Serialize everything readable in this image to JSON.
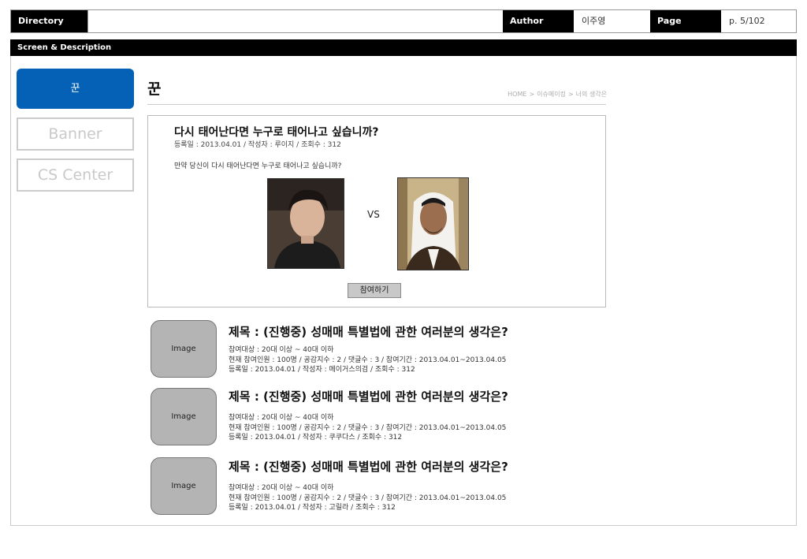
{
  "header": {
    "directory_label": "Directory",
    "directory_value": "",
    "author_label": "Author",
    "author_value": "이주영",
    "page_label": "Page",
    "page_value": "p. 5/102"
  },
  "section_bar": "Screen & Description",
  "menu": {
    "active": "꾼",
    "items": [
      "Banner",
      "CS Center"
    ]
  },
  "page_title": "꾼",
  "breadcrumb": [
    "HOME",
    "이슈메이킹",
    "너의 생각은"
  ],
  "poll": {
    "question": "다시 태어난다면 누구로 태어나고 싶습니까?",
    "meta": "등록일 : 2013.04.01 / 작성자 : 루이지 / 조회수 : 312",
    "description": "만약 당신이 다시 태어난다면 누구로 태어나고 싶습니까?",
    "vs": "VS",
    "join_button": "참여하기"
  },
  "list": [
    {
      "thumb": "Image",
      "title": "제목 : (진행중) 성매매 특별법에 관한 여러분의 생각은?",
      "target": "참여대상 : 20대 이상 ~ 40대 이하",
      "stats": "현재 참여인원 : 100명 / 공감지수 : 2 / 댓글수 : 3 / 참여기간 : 2013.04.01~2013.04.05",
      "meta": "등록일 : 2013.04.01 / 작성자 : 메이거스의검 / 조회수 : 312"
    },
    {
      "thumb": "Image",
      "title": "제목 : (진행중) 성매매 특별법에 관한 여러분의 생각은?",
      "target": "참여대상 : 20대 이상 ~ 40대 이하",
      "stats": "현재 참여인원 : 100명 / 공감지수 : 2 / 댓글수 : 3 / 참여기간 : 2013.04.01~2013.04.05",
      "meta": "등록일 : 2013.04.01 / 작성자 : 쿠쿠다스 / 조회수 : 312"
    },
    {
      "thumb": "Image",
      "title": "제목 : (진행중) 성매매 특별법에 관한 여러분의 생각은?",
      "target": "참여대상 : 20대 이상 ~ 40대 이하",
      "stats": "현재 참여인원 : 100명 / 공감지수 : 2 / 댓글수 : 3 / 참여기간 : 2013.04.01~2013.04.05",
      "meta": "등록일 : 2013.04.01 / 작성자 : 고릴라 / 조회수 : 312"
    }
  ],
  "colors": {
    "accent": "#0561b5",
    "header_bg": "#000000",
    "thumb_bg": "#b4b4b4"
  }
}
